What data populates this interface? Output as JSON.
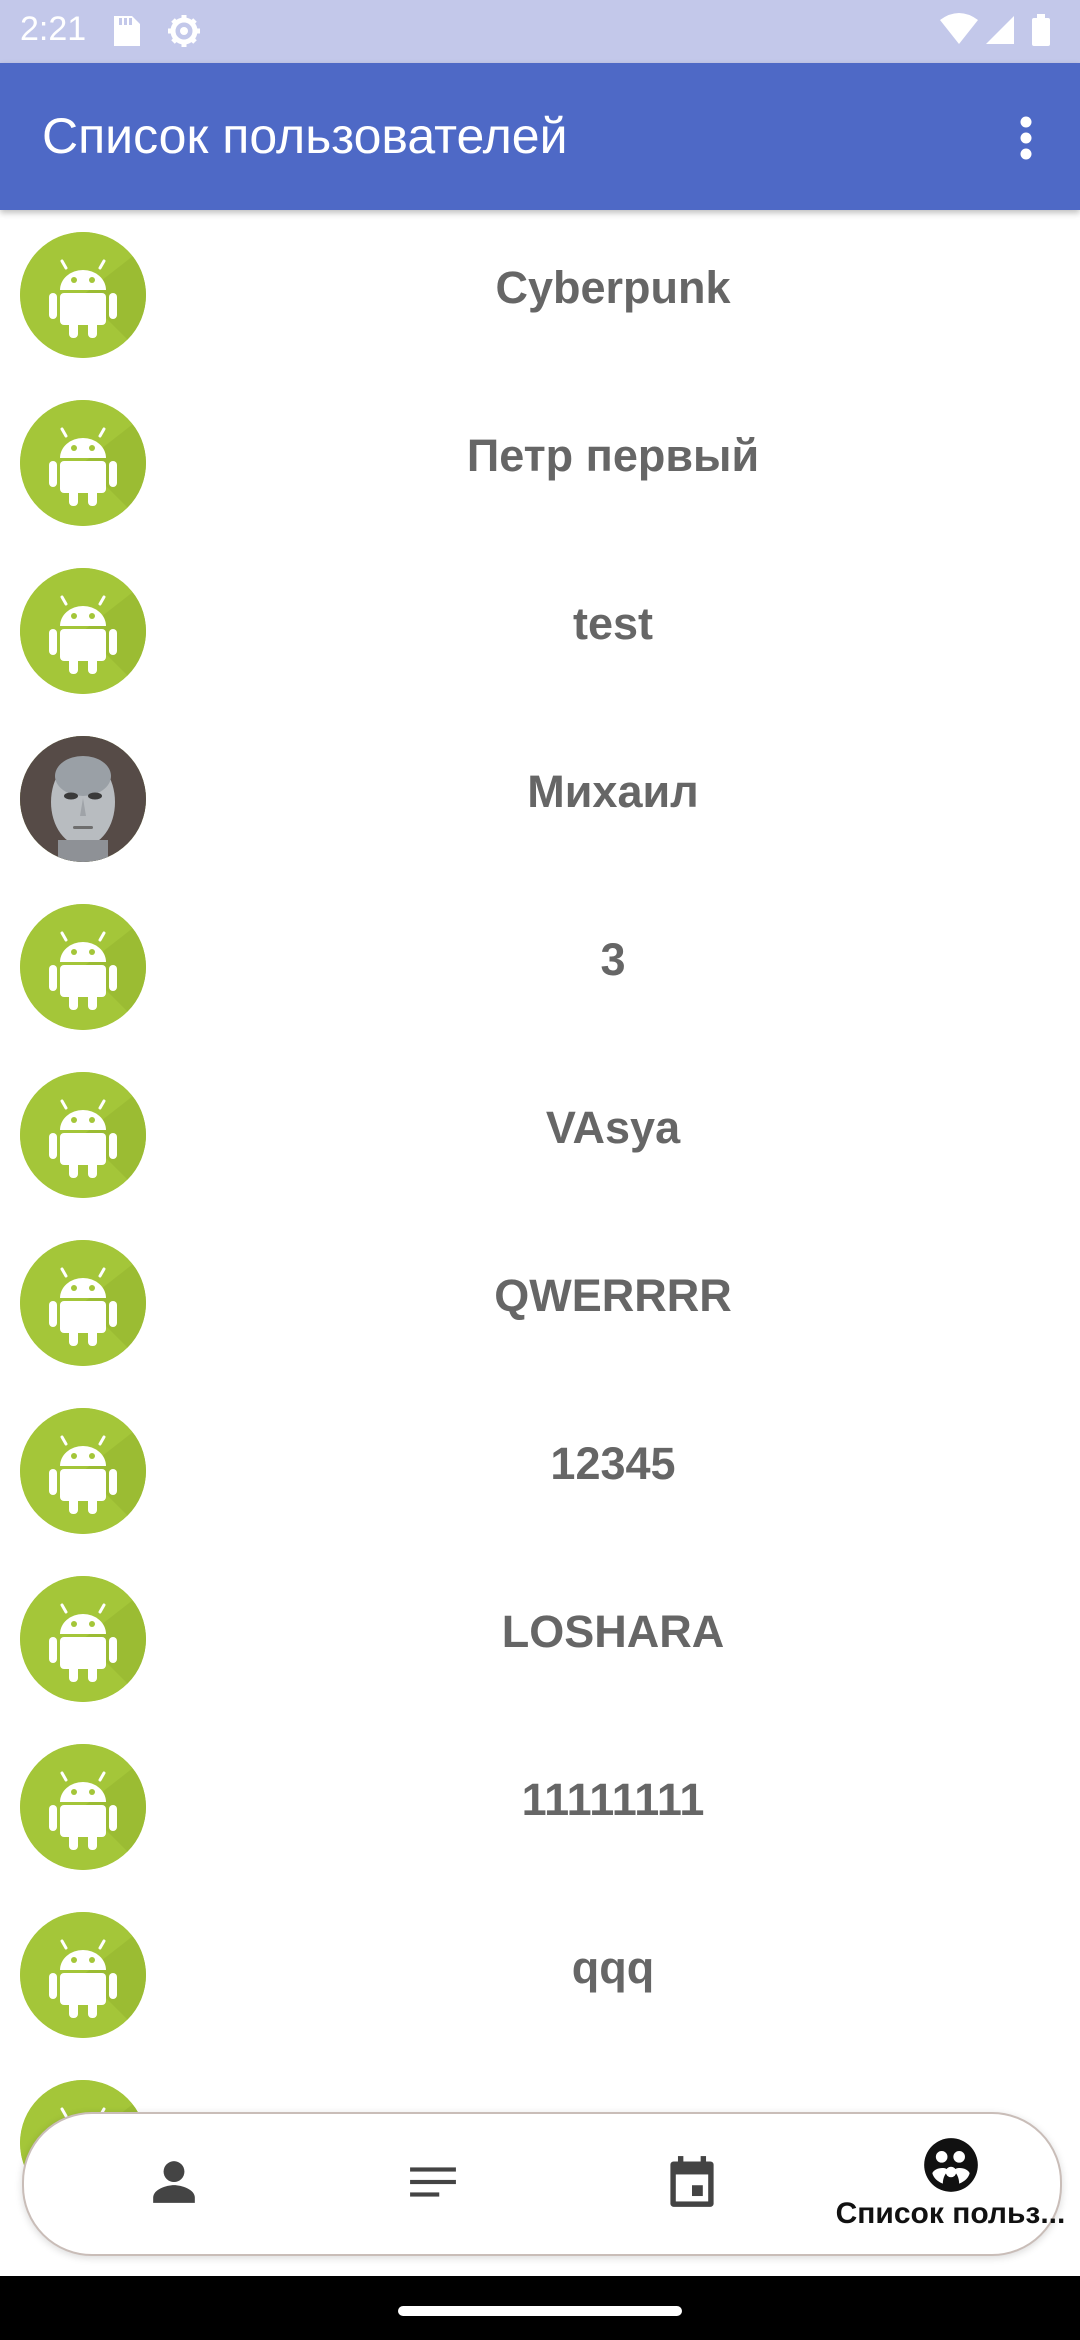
{
  "status_bar": {
    "time": "2:21",
    "icons_left": [
      "sd-card-icon",
      "settings-gear-icon"
    ],
    "icons_right": [
      "wifi-icon",
      "cell-signal-icon",
      "battery-icon"
    ],
    "background": "#c3c8ea"
  },
  "app_bar": {
    "title": "Список пользователей",
    "overflow_icon": "more-vert-icon",
    "background": "#4e69c6"
  },
  "users": [
    {
      "name": "Cyberpunk",
      "avatar": "android-icon"
    },
    {
      "name": "Петр первый",
      "avatar": "android-icon"
    },
    {
      "name": "test",
      "avatar": "android-icon"
    },
    {
      "name": "Михаил",
      "avatar": "photo"
    },
    {
      "name": "3",
      "avatar": "android-icon"
    },
    {
      "name": "VAsya",
      "avatar": "android-icon"
    },
    {
      "name": "QWERRRR",
      "avatar": "android-icon"
    },
    {
      "name": "12345",
      "avatar": "android-icon"
    },
    {
      "name": "LOSHARA",
      "avatar": "android-icon"
    },
    {
      "name": "11111111",
      "avatar": "android-icon"
    },
    {
      "name": "qqq",
      "avatar": "android-icon"
    },
    {
      "name": "",
      "avatar": "android-icon"
    }
  ],
  "bottom_nav": {
    "items": [
      {
        "icon": "person-icon",
        "label": ""
      },
      {
        "icon": "notes-icon",
        "label": ""
      },
      {
        "icon": "calendar-icon",
        "label": ""
      },
      {
        "icon": "group-icon",
        "label": "Список польз...",
        "selected": true
      }
    ]
  },
  "colors": {
    "android_green": "#a4c639",
    "name_text": "#666666",
    "accent": "#4e69c6"
  }
}
